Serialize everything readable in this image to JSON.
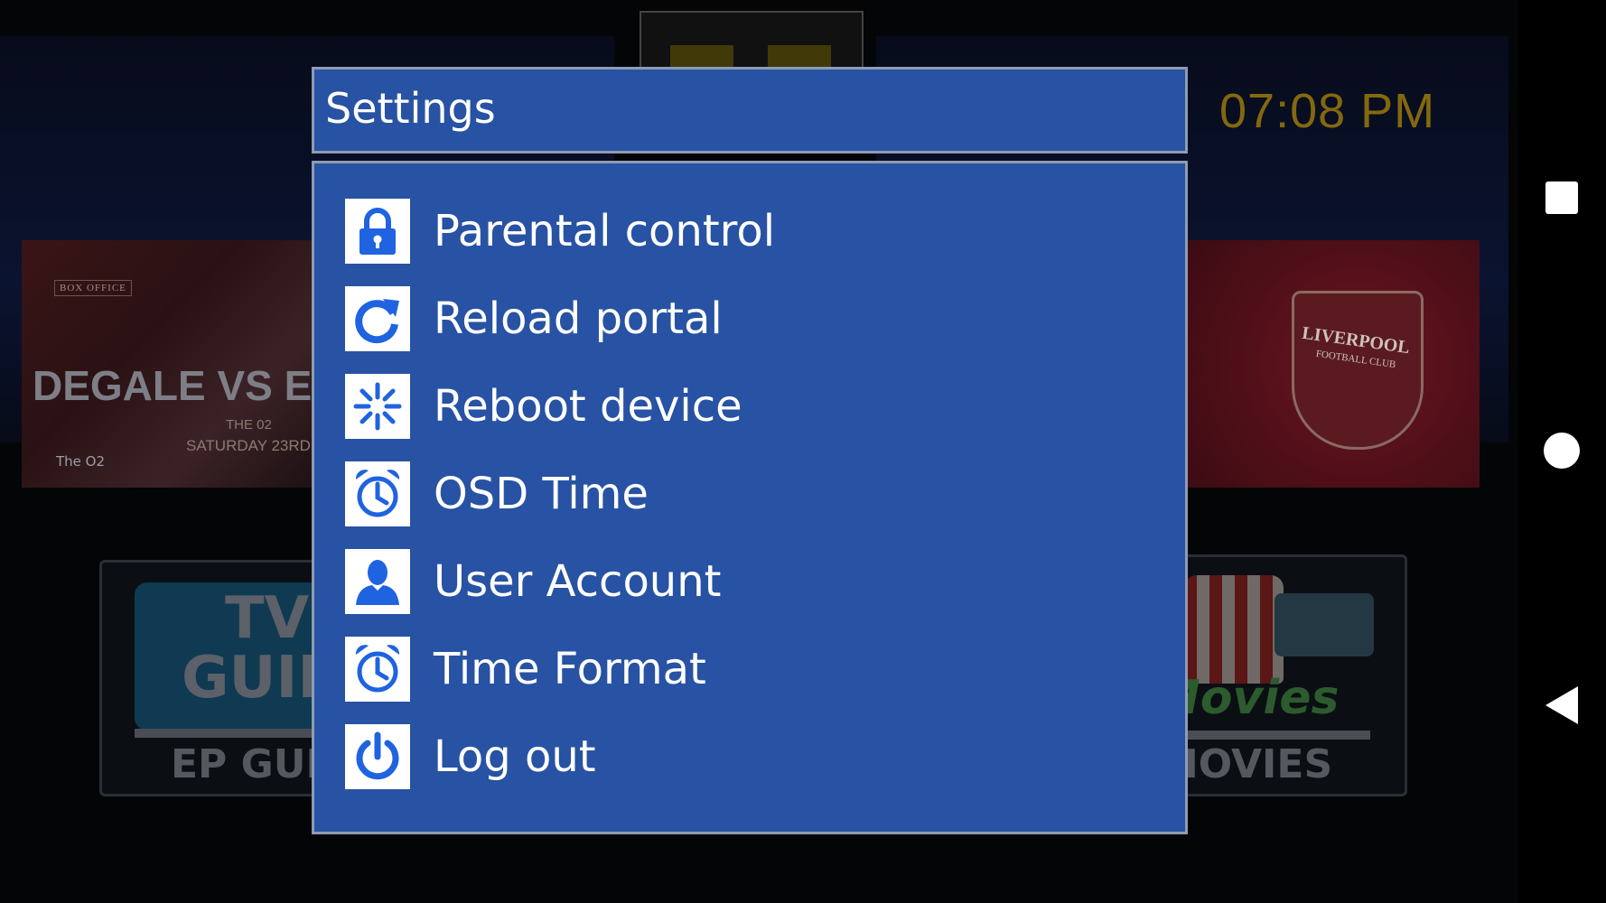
{
  "clock": {
    "time": "07:08 PM"
  },
  "background": {
    "banner_left": {
      "tag": "BOX OFFICE",
      "headline": "DEGALE VS EUB",
      "venue": "THE 02",
      "date": "SATURDAY 23RD FEBRU",
      "sponsor": "The O2"
    },
    "banner_right": {
      "crest_title": "LIVERPOOL",
      "crest_sub": "FOOTBALL CLUB"
    },
    "tile_left": {
      "title_line1": "TV",
      "title_line2": "GUIDE",
      "label": "EP GUIDE"
    },
    "tile_right": {
      "title": "Movies",
      "label": "MOVIES"
    }
  },
  "dialog": {
    "title": "Settings",
    "items": [
      {
        "label": "Parental control",
        "icon": "lock-icon"
      },
      {
        "label": "Reload portal",
        "icon": "reload-icon"
      },
      {
        "label": "Reboot device",
        "icon": "reboot-icon"
      },
      {
        "label": "OSD Time",
        "icon": "alarm-clock-icon"
      },
      {
        "label": "User Account",
        "icon": "user-icon"
      },
      {
        "label": "Time Format",
        "icon": "alarm-clock-icon"
      },
      {
        "label": "Log out",
        "icon": "power-icon"
      }
    ]
  },
  "colors": {
    "dialog_bg": "#2852a3",
    "dialog_border": "#8f9bb3",
    "icon_blue": "#1f63e0",
    "clock_gold": "#84680e"
  }
}
